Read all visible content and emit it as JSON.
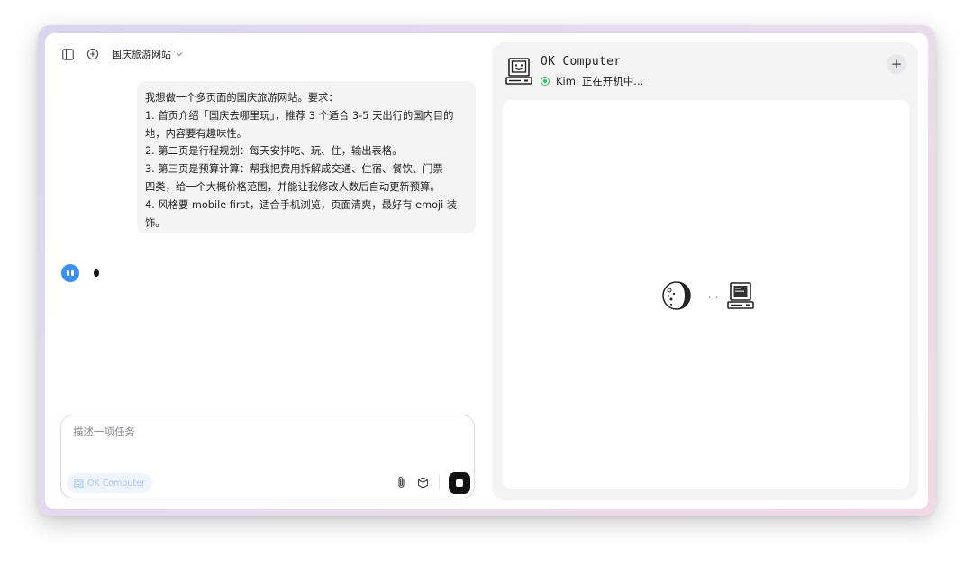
{
  "conversation": {
    "title": "国庆旅游网站"
  },
  "user_message": {
    "lines": [
      "我想做一个多页面的国庆旅游网站。要求：",
      "1. 首页介绍「国庆去哪里玩」，推荐 3 个适合 3-5 天出行的国内目的",
      "地，内容要有趣味性。",
      "2. 第二页是行程规划：每天安排吃、玩、住，输出表格。",
      "3. 第三页是预算计算：帮我把费用拆解成交通、住宿、餐饮、门票",
      "四类，给一个大概价格范围，并能让我修改人数后自动更新预算。",
      "4. 风格要 mobile first，适合手机浏览，页面清爽，最好有 emoji 装",
      "饰。"
    ]
  },
  "assistant": {
    "avatar_icon": "kimi-avatar-icon",
    "state": "typing"
  },
  "composer": {
    "placeholder": "描述一项任务",
    "mode_chip": "OK Computer",
    "icons": [
      "paperclip-icon",
      "cube-icon",
      "stop-icon"
    ]
  },
  "computer_panel": {
    "title": "OK Computer",
    "status": "Kimi 正在开机中...",
    "status_color": "#34c25b",
    "boot_animation": {
      "icons": [
        "moon-icon",
        "computer-icon"
      ],
      "dots": "··"
    }
  },
  "colors": {
    "accent": "#3d8ef7",
    "chip_bg": "#eef5ff",
    "chip_text": "#a8c6f0"
  }
}
